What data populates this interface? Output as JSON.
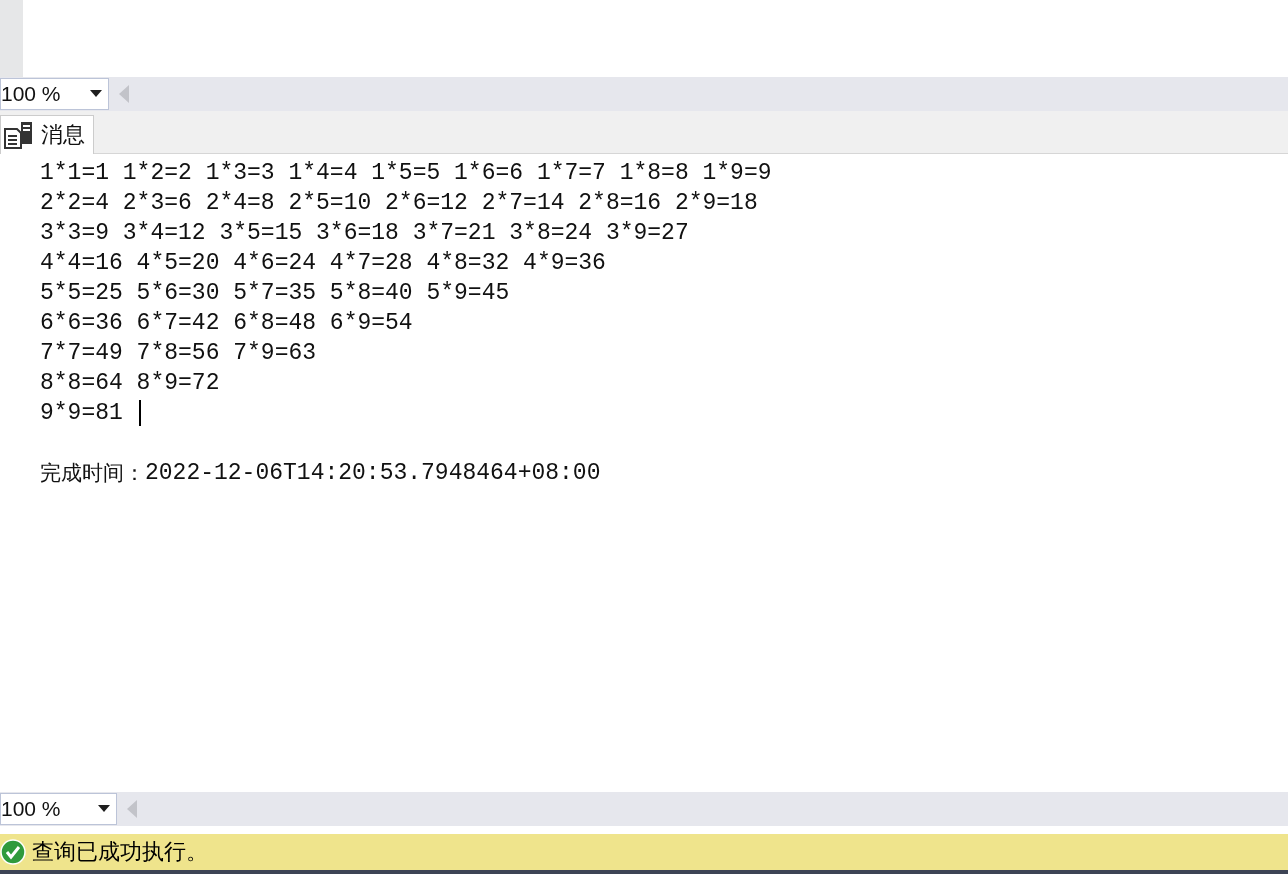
{
  "editor_zoom": {
    "value": "100 %"
  },
  "results_tabs": [
    {
      "label": "消息",
      "selected": true
    }
  ],
  "messages": {
    "lines": [
      "1*1=1 1*2=2 1*3=3 1*4=4 1*5=5 1*6=6 1*7=7 1*8=8 1*9=9",
      "2*2=4 2*3=6 2*4=8 2*5=10 2*6=12 2*7=14 2*8=16 2*9=18",
      "3*3=9 3*4=12 3*5=15 3*6=18 3*7=21 3*8=24 3*9=27",
      "4*4=16 4*5=20 4*6=24 4*7=28 4*8=32 4*9=36",
      "5*5=25 5*6=30 5*7=35 5*8=40 5*9=45",
      "6*6=36 6*7=42 6*8=48 6*9=54",
      "7*7=49 7*8=56 7*9=63",
      "8*8=64 8*9=72",
      "9*9=81"
    ],
    "completion_label": "完成时间：",
    "completion_time": "2022-12-06T14:20:53.7948464+08:00"
  },
  "results_zoom": {
    "value": "100 %"
  },
  "status_bar": {
    "message": "查询已成功执行。",
    "success": true
  }
}
